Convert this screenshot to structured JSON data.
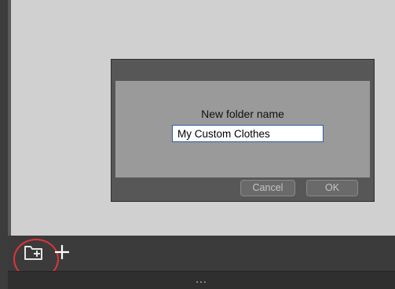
{
  "dialog": {
    "prompt": "New folder name",
    "input_value": "My Custom Clothes",
    "cancel_label": "Cancel",
    "ok_label": "OK"
  },
  "toolbar": {
    "new_folder_icon": "new-folder-icon",
    "add_icon": "plus-icon",
    "highlight_color": "#e0343a"
  },
  "status_bar": {
    "more_label": "..."
  }
}
